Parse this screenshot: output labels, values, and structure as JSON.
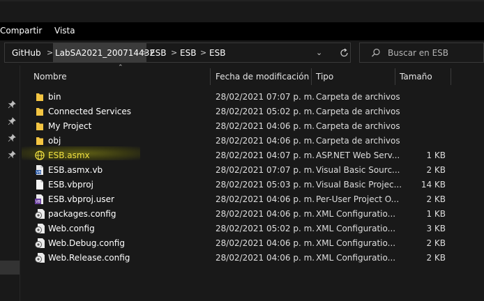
{
  "ribbon": {
    "tabs": [
      "Compartir",
      "Vista"
    ]
  },
  "address": {
    "crumbs": [
      "GitHub",
      "LabSA2021_200714432",
      "ESB",
      "ESB",
      "ESB"
    ],
    "separator": ">",
    "dropdown_glyph": "⌄"
  },
  "search": {
    "placeholder": "Buscar en ESB"
  },
  "columns": {
    "name": "Nombre",
    "date": "Fecha de modificación",
    "type": "Tipo",
    "size": "Tamaño"
  },
  "files": [
    {
      "name": "bin",
      "date": "28/02/2021 07:07 p. m.",
      "type": "Carpeta de archivos",
      "size": "",
      "icon": "folder-icon"
    },
    {
      "name": "Connected Services",
      "date": "28/02/2021 05:02 p. m.",
      "type": "Carpeta de archivos",
      "size": "",
      "icon": "folder-icon"
    },
    {
      "name": "My Project",
      "date": "28/02/2021 04:06 p. m.",
      "type": "Carpeta de archivos",
      "size": "",
      "icon": "folder-icon"
    },
    {
      "name": "obj",
      "date": "28/02/2021 04:06 p. m.",
      "type": "Carpeta de archivos",
      "size": "",
      "icon": "folder-icon"
    },
    {
      "name": "ESB.asmx",
      "date": "28/02/2021 04:07 p. m.",
      "type": "ASP.NET Web Serv...",
      "size": "1 KB",
      "icon": "web-service-icon",
      "highlighted": true
    },
    {
      "name": "ESB.asmx.vb",
      "date": "28/02/2021 07:07 p. m.",
      "type": "Visual Basic Sourc...",
      "size": "2 KB",
      "icon": "vb-file-icon"
    },
    {
      "name": "ESB.vbproj",
      "date": "28/02/2021 05:03 p. m.",
      "type": "Visual Basic Projec...",
      "size": "14 KB",
      "icon": "document-icon"
    },
    {
      "name": "ESB.vbproj.user",
      "date": "28/02/2021 04:06 p. m.",
      "type": "Per-User Project O...",
      "size": "2 KB",
      "icon": "project-user-icon"
    },
    {
      "name": "packages.config",
      "date": "28/02/2021 04:06 p. m.",
      "type": "XML Configuratio...",
      "size": "1 KB",
      "icon": "config-file-icon"
    },
    {
      "name": "Web.config",
      "date": "28/02/2021 05:02 p. m.",
      "type": "XML Configuratio...",
      "size": "3 KB",
      "icon": "config-file-icon"
    },
    {
      "name": "Web.Debug.config",
      "date": "28/02/2021 04:06 p. m.",
      "type": "XML Configuratio...",
      "size": "2 KB",
      "icon": "config-file-icon"
    },
    {
      "name": "Web.Release.config",
      "date": "28/02/2021 04:06 p. m.",
      "type": "XML Configuratio...",
      "size": "2 KB",
      "icon": "config-file-icon"
    }
  ],
  "colors": {
    "background": "#191919",
    "ribbon": "#000000",
    "folder": "#f4c542",
    "highlight": "#7a7a14",
    "highlight_text": "#f0e040"
  }
}
